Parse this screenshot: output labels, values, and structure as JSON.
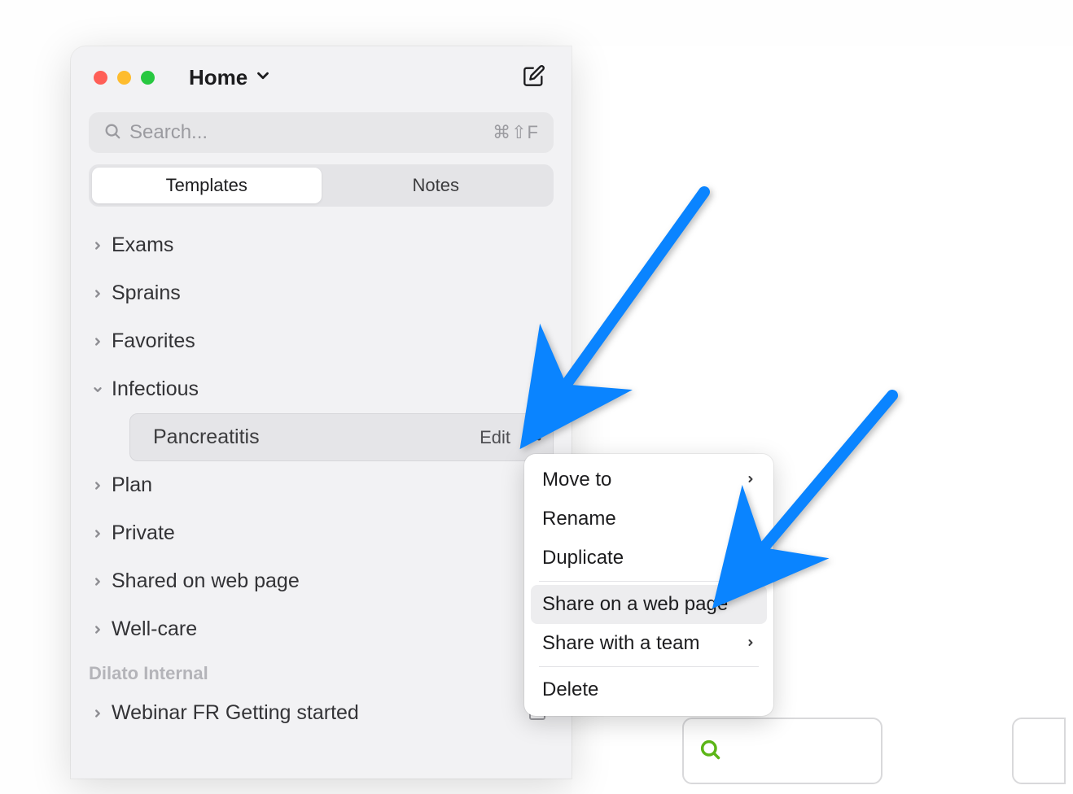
{
  "titlebar": {
    "title": "Home"
  },
  "search": {
    "placeholder": "Search...",
    "shortcut": "⌘⇧F"
  },
  "tabs": {
    "templates": "Templates",
    "notes": "Notes"
  },
  "tree": {
    "items": [
      {
        "label": "Exams",
        "expanded": false
      },
      {
        "label": "Sprains",
        "expanded": false
      },
      {
        "label": "Favorites",
        "expanded": false
      },
      {
        "label": "Infectious",
        "expanded": true
      },
      {
        "label": "Plan",
        "expanded": false
      },
      {
        "label": "Private",
        "expanded": false
      },
      {
        "label": "Shared on web page",
        "expanded": false
      },
      {
        "label": "Well-care",
        "expanded": false
      }
    ],
    "selected_child": {
      "label": "Pancreatitis",
      "edit_label": "Edit"
    },
    "section_header": "Dilato Internal",
    "section_items": [
      {
        "label": "Webinar FR Getting started"
      }
    ]
  },
  "context_menu": {
    "items": [
      {
        "label": "Move to",
        "has_submenu": true,
        "highlighted": false
      },
      {
        "label": "Rename",
        "has_submenu": false,
        "highlighted": false
      },
      {
        "label": "Duplicate",
        "has_submenu": false,
        "highlighted": false
      }
    ],
    "items2": [
      {
        "label": "Share on a web page",
        "has_submenu": false,
        "highlighted": true
      },
      {
        "label": "Share with a team",
        "has_submenu": true,
        "highlighted": false
      }
    ],
    "items3": [
      {
        "label": "Delete",
        "has_submenu": false,
        "highlighted": false
      }
    ]
  },
  "colors": {
    "arrow": "#0a84ff",
    "green_search": "#5cb617"
  }
}
